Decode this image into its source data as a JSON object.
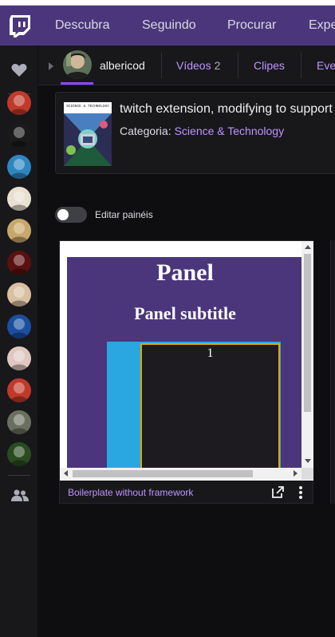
{
  "topnav": {
    "items": [
      {
        "label": "Descubra"
      },
      {
        "label": "Seguindo"
      },
      {
        "label": "Procurar"
      },
      {
        "label": "Expe"
      }
    ]
  },
  "sidebar": {
    "avatars": [
      {
        "name": "followed-channel-1",
        "color": "#c0392b"
      },
      {
        "name": "followed-channel-2",
        "color": "#1a1a1a"
      },
      {
        "name": "followed-channel-3",
        "color": "#2e86c1"
      },
      {
        "name": "followed-channel-4",
        "color": "#e8e0d0"
      },
      {
        "name": "followed-channel-5",
        "color": "#c8a86a"
      },
      {
        "name": "followed-channel-6",
        "color": "#5a1010"
      },
      {
        "name": "followed-channel-7",
        "color": "#d8c0a0"
      },
      {
        "name": "followed-channel-8",
        "color": "#1a4fa0"
      },
      {
        "name": "followed-channel-9",
        "color": "#e0c8c0"
      },
      {
        "name": "followed-channel-10",
        "color": "#c0392b"
      },
      {
        "name": "followed-channel-11",
        "color": "#6a7060"
      },
      {
        "name": "followed-channel-12",
        "color": "#2a4a20"
      }
    ]
  },
  "channel": {
    "name": "albericod",
    "tabs": [
      {
        "label": "Vídeos",
        "count": "2"
      },
      {
        "label": "Clipes",
        "count": ""
      },
      {
        "label": "Eve",
        "count": ""
      }
    ]
  },
  "stream": {
    "title": "twitch extension, modifying to support",
    "category_label": "Categoria:",
    "category": "Science & Technology",
    "box_art_text": "SCIENCE & TECHNOLOGY"
  },
  "panels": {
    "edit_label": "Editar painéis",
    "edit_enabled": false,
    "panel": {
      "title": "Panel",
      "subtitle": "Panel subtitle",
      "box_number": "1",
      "footer_name": "Boilerplate without framework"
    }
  },
  "colors": {
    "brand": "#4b367c",
    "accent": "#bf94ff",
    "background": "#0e0e10",
    "sidebar": "#18181b"
  }
}
